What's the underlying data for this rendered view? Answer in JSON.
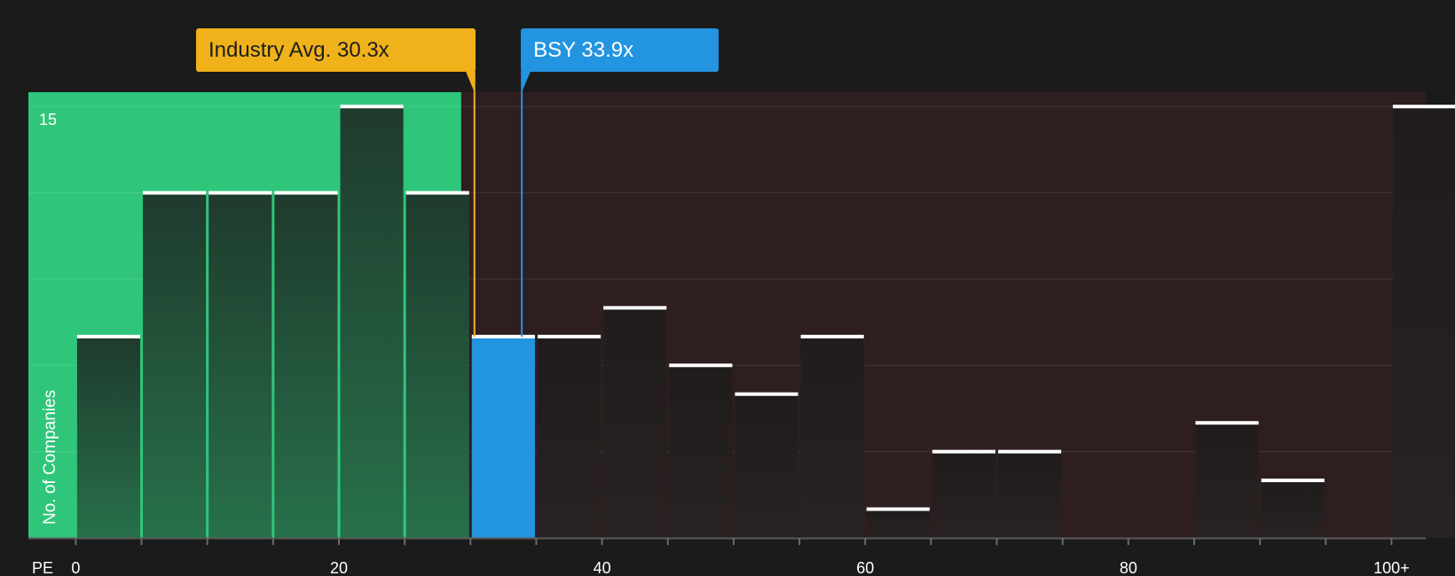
{
  "chart_data": {
    "type": "bar",
    "ylabel": "No. of Companies",
    "xlabel": "PE",
    "x_tick_labels": [
      "0",
      "20",
      "40",
      "60",
      "80",
      "100+"
    ],
    "x_ticks": [
      0,
      20,
      40,
      60,
      80,
      100
    ],
    "y_tick_labels": [
      "15"
    ],
    "y_ticks": [
      15
    ],
    "ylim": [
      0,
      15.5
    ],
    "xlim": [
      -3.6,
      102.6
    ],
    "bin_width": 5,
    "bins": [
      {
        "start": 0,
        "value": 7
      },
      {
        "start": 5,
        "value": 12
      },
      {
        "start": 10,
        "value": 12
      },
      {
        "start": 15,
        "value": 12
      },
      {
        "start": 20,
        "value": 15
      },
      {
        "start": 25,
        "value": 12
      },
      {
        "start": 30,
        "value": 7,
        "highlight": true
      },
      {
        "start": 35,
        "value": 7
      },
      {
        "start": 40,
        "value": 8
      },
      {
        "start": 45,
        "value": 6
      },
      {
        "start": 50,
        "value": 5
      },
      {
        "start": 55,
        "value": 7
      },
      {
        "start": 60,
        "value": 1
      },
      {
        "start": 65,
        "value": 3
      },
      {
        "start": 70,
        "value": 3
      },
      {
        "start": 75,
        "value": 0
      },
      {
        "start": 80,
        "value": 0
      },
      {
        "start": 85,
        "value": 4
      },
      {
        "start": 90,
        "value": 2
      },
      {
        "start": 95,
        "value": 0
      },
      {
        "start": 100,
        "value": 15
      }
    ],
    "industry_avg": {
      "label": "Industry Avg. 30.3x",
      "value": 30.3
    },
    "company": {
      "label": "BSY 33.9x",
      "value": 33.9
    },
    "grid": true,
    "colors": {
      "background": "#1b1b1b",
      "below_avg_region": "#2fc67b",
      "above_avg_region": "#2e1e1f",
      "bar_dark": "#1f2320",
      "company_bar": "#2394e0",
      "industry_line": "#f0b21a",
      "company_line": "#2394e0",
      "cap": "#ffffff"
    }
  }
}
